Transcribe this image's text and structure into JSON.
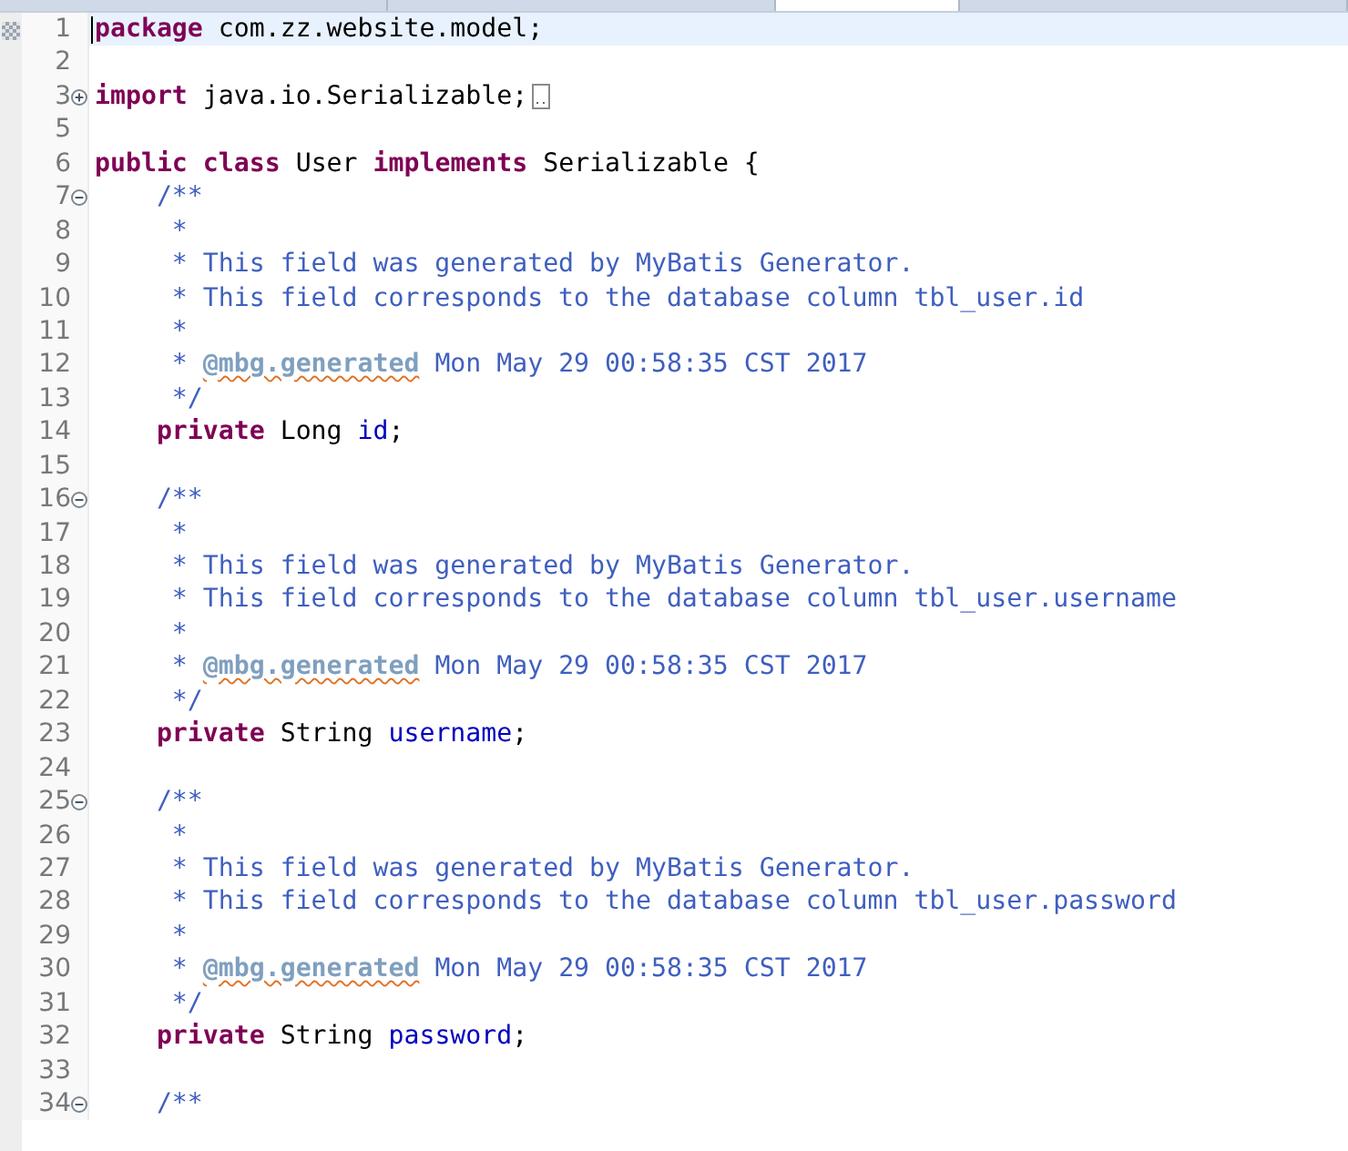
{
  "tabs": [
    {
      "selected": false
    },
    {
      "selected": false
    },
    {
      "selected": true
    },
    {
      "selected": false
    }
  ],
  "lines": [
    {
      "number": "1",
      "current": true,
      "tokens": [
        {
          "kind": "keyword",
          "text": "package"
        },
        {
          "kind": "plain",
          "text": " com.zz.website.model;"
        }
      ]
    },
    {
      "number": "2"
    },
    {
      "number": "3",
      "expanded": false,
      "folded_marker": true,
      "tokens": [
        {
          "kind": "keyword",
          "text": "import"
        },
        {
          "kind": "plain",
          "text": " java.io.Serializable;"
        }
      ]
    },
    {
      "number": "5"
    },
    {
      "number": "6",
      "tokens": [
        {
          "kind": "keyword",
          "text": "public"
        },
        {
          "kind": "keyword",
          "text": " class"
        },
        {
          "kind": "plain",
          "text": " User "
        },
        {
          "kind": "keyword",
          "text": "implements"
        },
        {
          "kind": "plain",
          "text": " Serializable {"
        }
      ]
    },
    {
      "number": "7",
      "expanded": true,
      "tokens": [
        {
          "kind": "javadoc",
          "text": "    /**"
        }
      ]
    },
    {
      "number": "8",
      "tokens": [
        {
          "kind": "javadoc",
          "text": "     *"
        }
      ]
    },
    {
      "number": "9",
      "tokens": [
        {
          "kind": "javadoc",
          "text": "     * This field was generated by MyBatis Generator."
        }
      ]
    },
    {
      "number": "10",
      "tokens": [
        {
          "kind": "javadoc",
          "text": "     * This field corresponds to the database column tbl_user.id"
        }
      ]
    },
    {
      "number": "11",
      "tokens": [
        {
          "kind": "javadoc",
          "text": "     *"
        }
      ]
    },
    {
      "number": "12",
      "tokens": [
        {
          "kind": "javadoc",
          "text": "     * "
        },
        {
          "kind": "tag",
          "text": "@mbg.generated"
        },
        {
          "kind": "javadoc",
          "text": " Mon May 29 00:58:35 CST 2017"
        }
      ]
    },
    {
      "number": "13",
      "tokens": [
        {
          "kind": "javadoc",
          "text": "     */"
        }
      ]
    },
    {
      "number": "14",
      "tokens": [
        {
          "kind": "keyword",
          "text": "    private"
        },
        {
          "kind": "plain",
          "text": " Long "
        },
        {
          "kind": "field",
          "text": "id"
        },
        {
          "kind": "plain",
          "text": ";"
        }
      ]
    },
    {
      "number": "15"
    },
    {
      "number": "16",
      "expanded": true,
      "tokens": [
        {
          "kind": "javadoc",
          "text": "    /**"
        }
      ]
    },
    {
      "number": "17",
      "tokens": [
        {
          "kind": "javadoc",
          "text": "     *"
        }
      ]
    },
    {
      "number": "18",
      "tokens": [
        {
          "kind": "javadoc",
          "text": "     * This field was generated by MyBatis Generator."
        }
      ]
    },
    {
      "number": "19",
      "tokens": [
        {
          "kind": "javadoc",
          "text": "     * This field corresponds to the database column tbl_user.username"
        }
      ]
    },
    {
      "number": "20",
      "tokens": [
        {
          "kind": "javadoc",
          "text": "     *"
        }
      ]
    },
    {
      "number": "21",
      "tokens": [
        {
          "kind": "javadoc",
          "text": "     * "
        },
        {
          "kind": "tag",
          "text": "@mbg.generated"
        },
        {
          "kind": "javadoc",
          "text": " Mon May 29 00:58:35 CST 2017"
        }
      ]
    },
    {
      "number": "22",
      "tokens": [
        {
          "kind": "javadoc",
          "text": "     */"
        }
      ]
    },
    {
      "number": "23",
      "tokens": [
        {
          "kind": "keyword",
          "text": "    private"
        },
        {
          "kind": "plain",
          "text": " String "
        },
        {
          "kind": "field",
          "text": "username"
        },
        {
          "kind": "plain",
          "text": ";"
        }
      ]
    },
    {
      "number": "24"
    },
    {
      "number": "25",
      "expanded": true,
      "tokens": [
        {
          "kind": "javadoc",
          "text": "    /**"
        }
      ]
    },
    {
      "number": "26",
      "tokens": [
        {
          "kind": "javadoc",
          "text": "     *"
        }
      ]
    },
    {
      "number": "27",
      "tokens": [
        {
          "kind": "javadoc",
          "text": "     * This field was generated by MyBatis Generator."
        }
      ]
    },
    {
      "number": "28",
      "tokens": [
        {
          "kind": "javadoc",
          "text": "     * This field corresponds to the database column tbl_user.password"
        }
      ]
    },
    {
      "number": "29",
      "tokens": [
        {
          "kind": "javadoc",
          "text": "     *"
        }
      ]
    },
    {
      "number": "30",
      "tokens": [
        {
          "kind": "javadoc",
          "text": "     * "
        },
        {
          "kind": "tag",
          "text": "@mbg.generated"
        },
        {
          "kind": "javadoc",
          "text": " Mon May 29 00:58:35 CST 2017"
        }
      ]
    },
    {
      "number": "31",
      "tokens": [
        {
          "kind": "javadoc",
          "text": "     */"
        }
      ]
    },
    {
      "number": "32",
      "tokens": [
        {
          "kind": "keyword",
          "text": "    private"
        },
        {
          "kind": "plain",
          "text": " String "
        },
        {
          "kind": "field",
          "text": "password"
        },
        {
          "kind": "plain",
          "text": ";"
        }
      ]
    },
    {
      "number": "33"
    },
    {
      "number": "34",
      "expanded": true,
      "tokens": [
        {
          "kind": "javadoc",
          "text": "    /**"
        }
      ]
    }
  ]
}
